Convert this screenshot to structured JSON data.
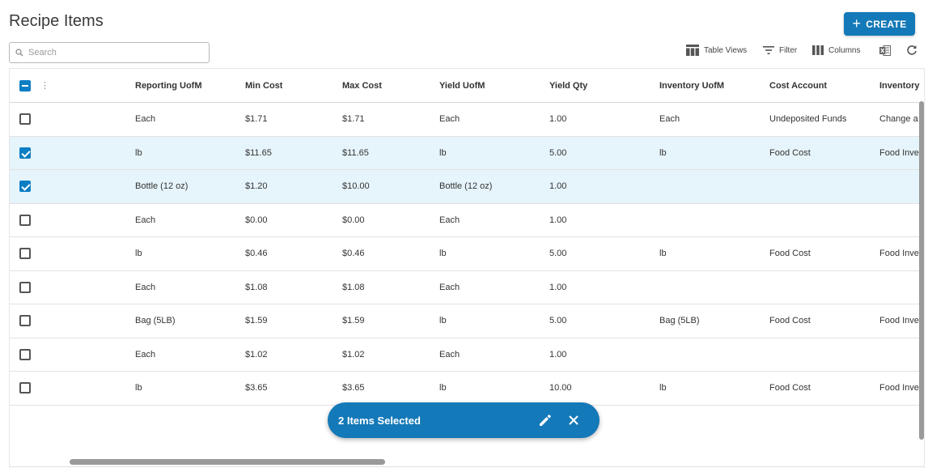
{
  "page": {
    "title": "Recipe Items"
  },
  "actions": {
    "create_label": "CREATE"
  },
  "search": {
    "placeholder": "Search",
    "value": ""
  },
  "toolbar": {
    "table_views": "Table Views",
    "filter": "Filter",
    "columns": "Columns"
  },
  "table": {
    "columns": [
      "Reporting UofM",
      "Min Cost",
      "Max Cost",
      "Yield UofM",
      "Yield Qty",
      "Inventory UofM",
      "Cost Account",
      "Inventory"
    ],
    "header_select_state": "indeterminate",
    "rows": [
      {
        "checked": false,
        "cells": [
          "Each",
          "$1.71",
          "$1.71",
          "Each",
          "1.00",
          "Each",
          "Undeposited Funds",
          "Change a"
        ]
      },
      {
        "checked": true,
        "cells": [
          "lb",
          "$11.65",
          "$11.65",
          "lb",
          "5.00",
          "lb",
          "Food Cost",
          "Food Inve"
        ]
      },
      {
        "checked": true,
        "cells": [
          "Bottle (12 oz)",
          "$1.20",
          "$10.00",
          "Bottle (12 oz)",
          "1.00",
          "",
          "",
          ""
        ]
      },
      {
        "checked": false,
        "cells": [
          "Each",
          "$0.00",
          "$0.00",
          "Each",
          "1.00",
          "",
          "",
          ""
        ]
      },
      {
        "checked": false,
        "cells": [
          "lb",
          "$0.46",
          "$0.46",
          "lb",
          "5.00",
          "lb",
          "Food Cost",
          "Food Inve"
        ]
      },
      {
        "checked": false,
        "cells": [
          "Each",
          "$1.08",
          "$1.08",
          "Each",
          "1.00",
          "",
          "",
          ""
        ]
      },
      {
        "checked": false,
        "cells": [
          "Bag (5LB)",
          "$1.59",
          "$1.59",
          "lb",
          "5.00",
          "Bag (5LB)",
          "Food Cost",
          "Food Inve"
        ]
      },
      {
        "checked": false,
        "cells": [
          "Each",
          "$1.02",
          "$1.02",
          "Each",
          "1.00",
          "",
          "",
          ""
        ]
      },
      {
        "checked": false,
        "cells": [
          "lb",
          "$3.65",
          "$3.65",
          "lb",
          "10.00",
          "lb",
          "Food Cost",
          "Food Inve"
        ]
      }
    ]
  },
  "selection": {
    "label": "2 Items Selected"
  },
  "colors": {
    "accent": "#1479b8",
    "selected_row": "#e6f4fb",
    "checkbox": "#0d7ec4"
  }
}
